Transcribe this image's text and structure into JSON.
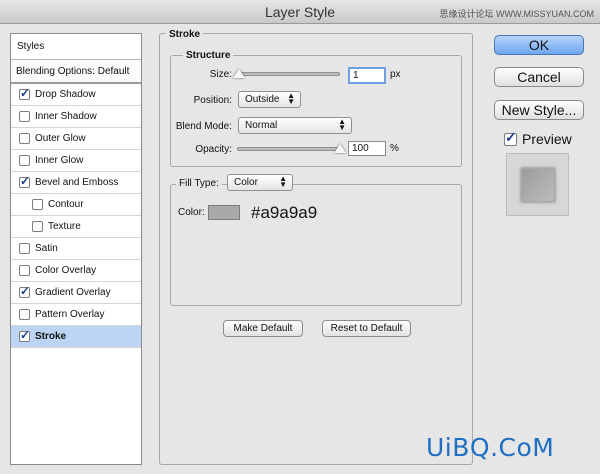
{
  "window": {
    "title": "Layer Style",
    "watermark_top": "思缘设计论坛 WWW.MISSYUAN.COM",
    "watermark_bottom": "UiBQ.CoM"
  },
  "styles_list": {
    "header": "Styles",
    "blending_options": "Blending Options: Default",
    "items": [
      {
        "label": "Drop Shadow",
        "checked": true
      },
      {
        "label": "Inner Shadow",
        "checked": false
      },
      {
        "label": "Outer Glow",
        "checked": false
      },
      {
        "label": "Inner Glow",
        "checked": false
      },
      {
        "label": "Bevel and Emboss",
        "checked": true
      },
      {
        "label": "Contour",
        "checked": false,
        "sub": true
      },
      {
        "label": "Texture",
        "checked": false,
        "sub": true
      },
      {
        "label": "Satin",
        "checked": false
      },
      {
        "label": "Color Overlay",
        "checked": false
      },
      {
        "label": "Gradient Overlay",
        "checked": true
      },
      {
        "label": "Pattern Overlay",
        "checked": false
      },
      {
        "label": "Stroke",
        "checked": true,
        "active": true
      }
    ]
  },
  "stroke": {
    "title": "Stroke",
    "structure_title": "Structure",
    "size_label": "Size:",
    "size_value": "1",
    "size_unit": "px",
    "position_label": "Position:",
    "position_value": "Outside",
    "blend_mode_label": "Blend Mode:",
    "blend_mode_value": "Normal",
    "opacity_label": "Opacity:",
    "opacity_value": "100",
    "opacity_unit": "%",
    "fill_type_label": "Fill Type:",
    "fill_type_value": "Color",
    "color_label": "Color:",
    "color_hex_text": "#a9a9a9",
    "swatch_color": "#a9a9a9",
    "make_default": "Make Default",
    "reset_default": "Reset to Default"
  },
  "buttons": {
    "ok": "OK",
    "cancel": "Cancel",
    "new_style": "New Style...",
    "preview_label": "Preview",
    "preview_checked": true
  },
  "colors": {
    "accent": "#6fa6ee",
    "selection": "#bcd5f5",
    "watermark": "#1f6fc4"
  }
}
